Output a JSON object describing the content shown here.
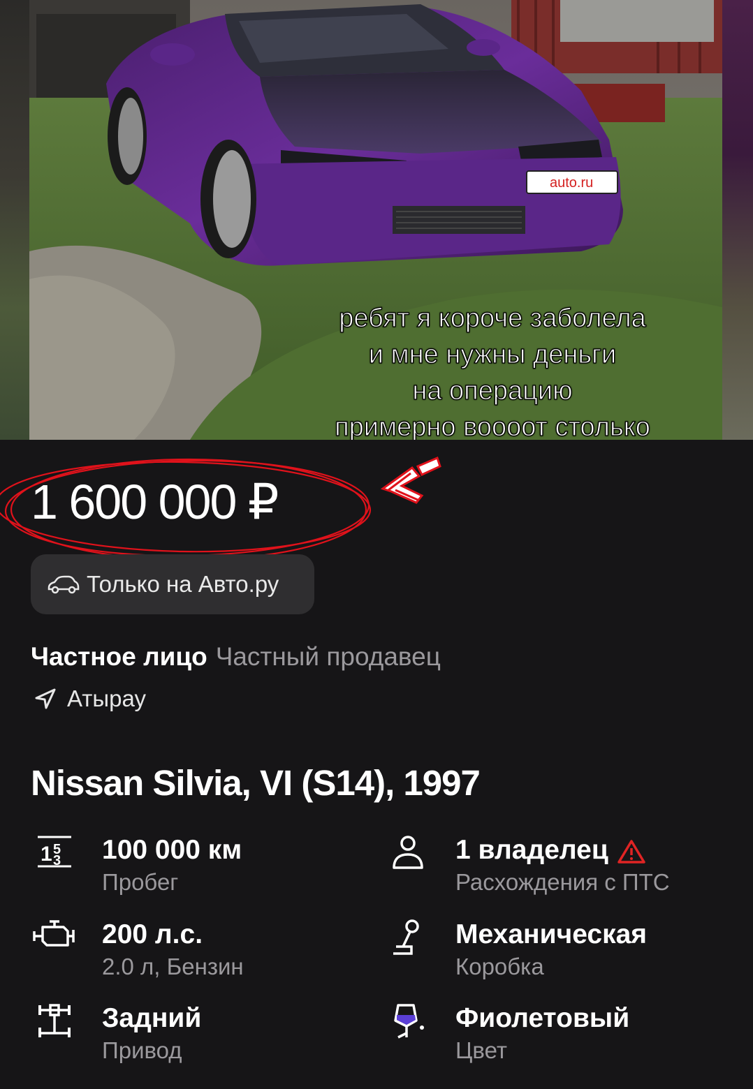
{
  "photo": {
    "caption_lines": [
      "ребят я короче заболела",
      "и мне нужны деньги",
      "на операцию",
      "примерно воооот столько"
    ],
    "plate_text": "auto.ru"
  },
  "listing": {
    "price": "1 600 000 ₽",
    "badge_label": "Только на Авто.ру",
    "seller_type": "Частное лицо",
    "seller_desc": "Частный продавец",
    "location": "Атырау",
    "title": "Nissan Silvia, VI (S14), 1997"
  },
  "specs": {
    "mileage": {
      "value": "100 000 км",
      "label": "Пробег",
      "icon": "odometer-icon"
    },
    "owners": {
      "value": "1 владелец",
      "label": "Расхождения с ПТС",
      "icon": "owner-icon",
      "warning_icon": "warning-icon"
    },
    "engine": {
      "value": "200 л.с.",
      "label": "2.0 л, Бензин",
      "icon": "engine-icon"
    },
    "gearbox": {
      "value": "Механическая",
      "label": "Коробка",
      "icon": "gearbox-icon"
    },
    "drive": {
      "value": "Задний",
      "label": "Привод",
      "icon": "drive-icon"
    },
    "color": {
      "value": "Фиолетовый",
      "label": "Цвет",
      "icon": "paint-icon",
      "swatch": "#5b3fd6"
    }
  },
  "colors": {
    "background": "#161517",
    "badge_bg": "#2f2e30",
    "secondary_text": "#9b999d",
    "annotation_red": "#e0121b",
    "warning_red": "#e02424"
  }
}
